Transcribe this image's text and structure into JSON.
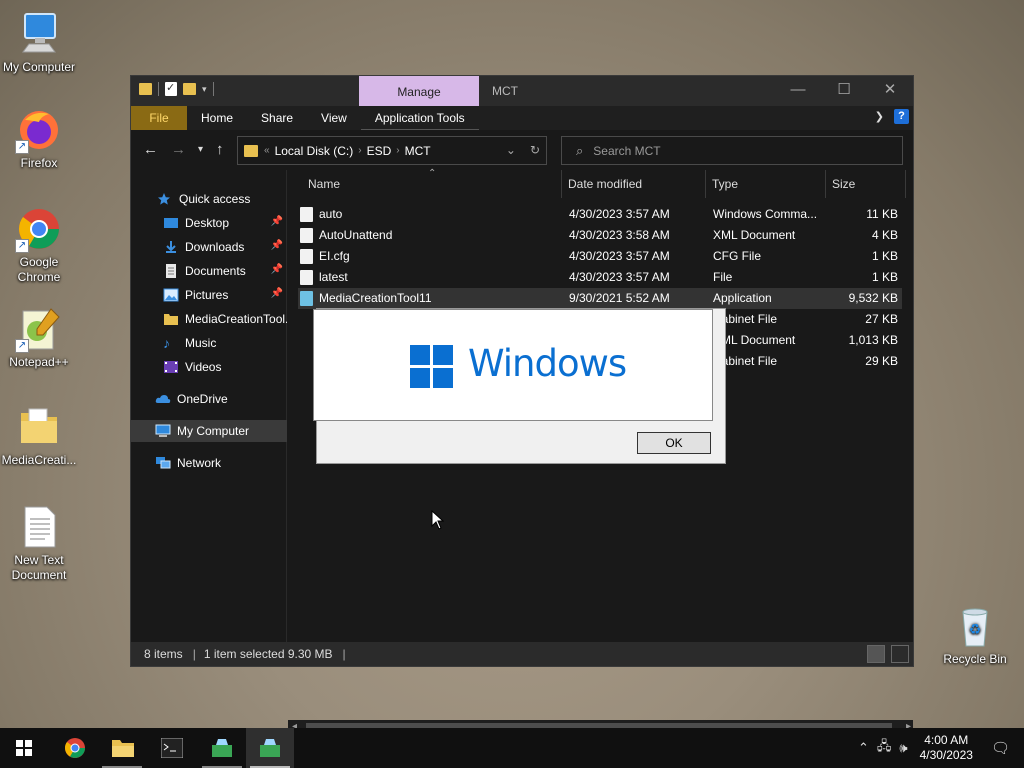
{
  "desktop": {
    "icons": [
      {
        "label": "My Computer",
        "icon": "computer-icon"
      },
      {
        "label": "Firefox",
        "icon": "firefox-icon"
      },
      {
        "label": "Google Chrome",
        "icon": "chrome-icon"
      },
      {
        "label": "Notepad++",
        "icon": "notepadpp-icon"
      },
      {
        "label": "MediaCreati...",
        "icon": "folder-icon"
      },
      {
        "label": "New Text Document",
        "icon": "text-document-icon"
      },
      {
        "label": "Recycle Bin",
        "icon": "recycle-bin-icon"
      }
    ]
  },
  "window": {
    "title": "MCT",
    "manage_tab": "Manage",
    "ribbon_tabs": [
      "File",
      "Home",
      "Share",
      "View",
      "Application Tools"
    ],
    "address": {
      "crumbs": [
        "Local Disk (C:)",
        "ESD",
        "MCT"
      ]
    },
    "search_placeholder": "Search MCT",
    "sidebar": [
      {
        "label": "Quick access",
        "icon": "star-icon",
        "pinned": false
      },
      {
        "label": "Desktop",
        "icon": "desktop-icon",
        "pinned": true
      },
      {
        "label": "Downloads",
        "icon": "download-icon",
        "pinned": true
      },
      {
        "label": "Documents",
        "icon": "documents-icon",
        "pinned": true
      },
      {
        "label": "Pictures",
        "icon": "pictures-icon",
        "pinned": true
      },
      {
        "label": "MediaCreationTool.",
        "icon": "folder-icon",
        "pinned": false
      },
      {
        "label": "Music",
        "icon": "music-icon",
        "pinned": false
      },
      {
        "label": "Videos",
        "icon": "videos-icon",
        "pinned": false
      },
      {
        "label": "OneDrive",
        "icon": "cloud-icon",
        "pinned": false
      },
      {
        "label": "My Computer",
        "icon": "computer-icon",
        "pinned": false
      },
      {
        "label": "Network",
        "icon": "network-icon",
        "pinned": false
      }
    ],
    "columns": [
      "Name",
      "Date modified",
      "Type",
      "Size"
    ],
    "files": [
      {
        "name": "auto",
        "date": "4/30/2023 3:57 AM",
        "type": "Windows Comma...",
        "size": "11 KB"
      },
      {
        "name": "AutoUnattend",
        "date": "4/30/2023 3:58 AM",
        "type": "XML Document",
        "size": "4 KB"
      },
      {
        "name": "EI.cfg",
        "date": "4/30/2023 3:57 AM",
        "type": "CFG File",
        "size": "1 KB"
      },
      {
        "name": "latest",
        "date": "4/30/2023 3:57 AM",
        "type": "File",
        "size": "1 KB"
      },
      {
        "name": "MediaCreationTool11",
        "date": "9/30/2021 5:52 AM",
        "type": "Application",
        "size": "9,532 KB"
      },
      {
        "name": "",
        "date": "",
        "type": "Cabinet File",
        "size": "27 KB"
      },
      {
        "name": "",
        "date": "",
        "type": "XML Document",
        "size": "1,013 KB"
      },
      {
        "name": "",
        "date": "",
        "type": "Cabinet File",
        "size": "29 KB"
      }
    ],
    "status": {
      "count": "8 items",
      "selection": "1 item selected  9.30 MB"
    }
  },
  "dialog": {
    "wordmark": "Windows",
    "ok_label": "OK"
  },
  "taskbar": {
    "time": "4:00 AM",
    "date": "4/30/2023"
  },
  "colors": {
    "accent": "#0a6fd1",
    "manage_tab": "#d7b8e8",
    "file_tab": "#8a6a14"
  }
}
